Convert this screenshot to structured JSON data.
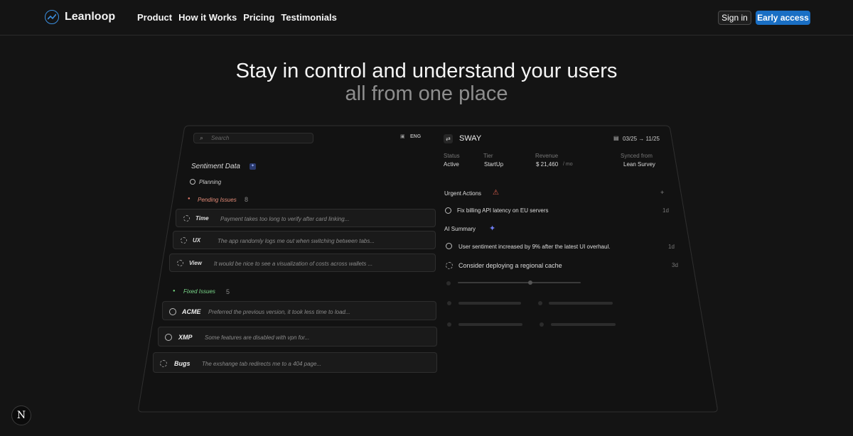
{
  "brand": {
    "name": "Leanloop",
    "accent": "#1a6fc4"
  },
  "nav": {
    "links": [
      "Product",
      "How it Works",
      "Pricing",
      "Testimonials"
    ],
    "signin": "Sign in",
    "early_access": "Early access"
  },
  "hero": {
    "line1": "Stay in control and understand your users",
    "line2": "all from one place"
  },
  "dashboard": {
    "search_placeholder": "Search",
    "language": "ENG",
    "sentiment_title": "Sentiment Data",
    "planning": "Planning",
    "pending": {
      "label": "Pending Issues",
      "count": "8"
    },
    "pending_items": [
      {
        "tag": "Time",
        "text": "Payment takes too long to verify after card linking..."
      },
      {
        "tag": "UX",
        "text": "The app randomly logs me out when switching between tabs..."
      },
      {
        "tag": "View",
        "text": "It would be nice to see a visualization of costs across wallets ..."
      }
    ],
    "fixed": {
      "label": "Fixed Issues",
      "count": "5"
    },
    "fixed_items": [
      {
        "tag": "ACME",
        "text": "Preferred the previous version, it took less time to load..."
      },
      {
        "tag": "XMP",
        "text": "Some features are disabled with vpn for..."
      },
      {
        "tag": "Bugs",
        "text": "The exshange tab redirects me to a 404 page..."
      }
    ],
    "account": {
      "name": "SWAY",
      "date_range": "03/25 → 11/25",
      "status_label": "Status",
      "status": "Active",
      "tier_label": "Tier",
      "tier": "StartUp",
      "revenue_label": "Revenue",
      "revenue": "$ 21,460",
      "revenue_unit": "/ mo",
      "synced_label": "Synced from",
      "synced": "Lean Survey"
    },
    "urgent": {
      "label": "Urgent Actions",
      "plus": "+",
      "items": [
        {
          "text": "Fix billing API latency on EU servers",
          "time": "1d"
        }
      ]
    },
    "ai": {
      "label": "AI Summary",
      "items": [
        {
          "text": "User sentiment increased by 9% after the latest UI overhaul.",
          "time": "1d"
        },
        {
          "text": "Consider deploying a regional cache",
          "time": "3d"
        }
      ]
    }
  },
  "badge": "N"
}
